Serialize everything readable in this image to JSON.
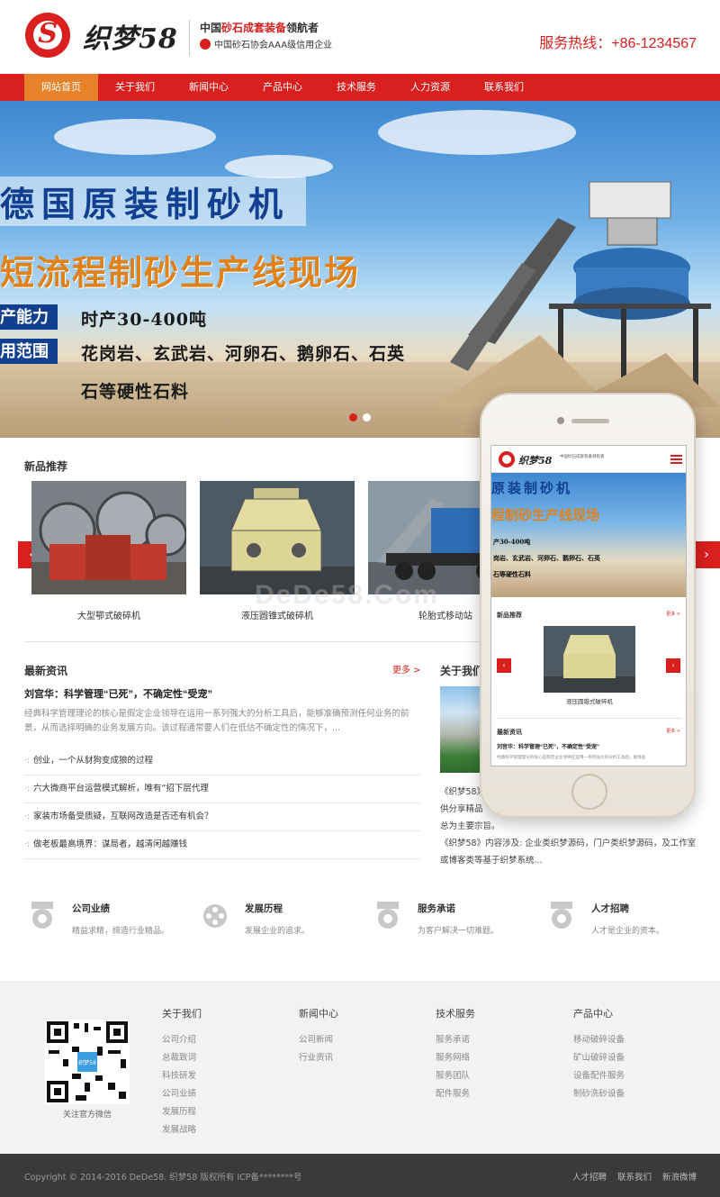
{
  "header": {
    "logo_text": "织梦58",
    "slogan_prefix": "中国",
    "slogan_highlight": "砂石成套装备",
    "slogan_suffix": "领航者",
    "slogan_sub": "中国砂石协会AAA级信用企业",
    "hotline": "服务热线：+86-1234567"
  },
  "nav": {
    "items": [
      "网站首页",
      "关于我们",
      "新闻中心",
      "产品中心",
      "技术服务",
      "人力资源",
      "联系我们"
    ],
    "active_index": 0
  },
  "banner": {
    "line1": "德国原装制砂机",
    "line2": "短流程制砂生产线现场",
    "tag1": "产能力",
    "val1": "时产30-400吨",
    "tag2": "用范围",
    "val2": "花岗岩、玄武岩、河卵石、鹅卵石、石英",
    "val3": "石等硬性石料",
    "slide_count": 2,
    "active_slide": 0
  },
  "products": {
    "title": "新品推荐",
    "items": [
      {
        "name": "大型鄂式破碎机",
        "icon": "jaw-crusher-image"
      },
      {
        "name": "液压圆锥式破碎机",
        "icon": "cone-crusher-image"
      },
      {
        "name": "轮胎式移动站",
        "icon": "mobile-station-image"
      }
    ],
    "prev_label": "‹",
    "next_label": "›",
    "watermark": "DeDe58.Com"
  },
  "news": {
    "title": "最新资讯",
    "more": "更多 >",
    "headline": "刘宫华：科学管理“已死”，不确定性“受宠”",
    "summary": "经典科学管理理论的核心是假定企业领导在运用一系列强大的分析工具后，能够准确预测任何业务的前景，从而选择明确的业务发展方向。该过程通常要人们在低估不确定性的情况下，...",
    "items": [
      "创业，一个从豺狗变成狼的过程",
      "六大微商平台运营模式解析，唯有“招下层代理",
      "家装市场备受质疑，互联网改造是否还有机会？",
      "做老板最高境界：谋局者，越清闲越赚钱"
    ]
  },
  "about": {
    "title": "关于我们",
    "text1": "《织梦58》",
    "text1b": "供分享精品",
    "text2": "总为主要宗旨。",
    "text3": "《织梦58》内容涉及: 企业类织梦源码，门户类织梦源码，及工作室或博客类等基于织梦系统..."
  },
  "features": [
    {
      "title": "公司业绩",
      "sub": "精益求精，缔造行业精品。",
      "icon": "medal-icon"
    },
    {
      "title": "发展历程",
      "sub": "发展企业的追求。",
      "icon": "film-reel-icon"
    },
    {
      "title": "服务承诺",
      "sub": "为客户解决一切难题。",
      "icon": "medal-icon"
    },
    {
      "title": "人才招聘",
      "sub": "人才是企业的资本。",
      "icon": "medal-icon"
    }
  ],
  "footer": {
    "qr_caption": "关注官方微信",
    "qr_center": "织梦58",
    "columns": [
      {
        "title": "关于我们",
        "links": [
          "公司介绍",
          "总裁致词",
          "科技研发",
          "公司业绩",
          "发展历程",
          "发展战略"
        ]
      },
      {
        "title": "新闻中心",
        "links": [
          "公司新闻",
          "行业资讯"
        ]
      },
      {
        "title": "技术服务",
        "links": [
          "服务承诺",
          "服务网络",
          "服务团队",
          "配件服务"
        ]
      },
      {
        "title": "产品中心",
        "links": [
          "移动破碎设备",
          "矿山破碎设备",
          "设备配件服务",
          "制砂洗砂设备"
        ]
      }
    ],
    "copyright": "Copyright © 2014-2016 DeDe58. 织梦58 版权所有   ICP备********号",
    "bottom_links": [
      "人才招聘",
      "联系我们",
      "新浪微博"
    ]
  },
  "phone": {
    "logo_text": "织梦58",
    "slogan": "中国砂石成套装备领航者",
    "banner_line1": "原装制砂机",
    "banner_line2": "程制砂生产线现场",
    "banner_val1": "产30-400吨",
    "banner_val2": "岗岩、玄武岩、河卵石、鹅卵石、石英",
    "banner_val3": "石等硬性石料",
    "products_title": "新品推荐",
    "more": "更多 >",
    "product_caption": "液压圆锥式破碎机",
    "news_title": "最新资讯",
    "news_headline": "刘宫华：科学管理“已死”，不确定性“受宠”",
    "news_summary": "经典科学管理理论的核心是假定企业领导在运用一系列强大的分析工具后，能够准"
  },
  "colors": {
    "brand_red": "#d9201f",
    "nav_active": "#e8822a",
    "banner_blue": "#123f8f",
    "banner_orange": "#e0821a"
  }
}
